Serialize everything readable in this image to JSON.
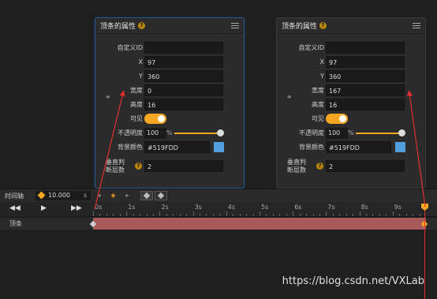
{
  "panels": [
    {
      "title": "顶条的属性",
      "help": "?",
      "fields": {
        "id_label": "自定义ID",
        "id_value": "",
        "x_label": "X",
        "x_value": "97",
        "y_label": "Y",
        "y_value": "360",
        "w_label": "宽度",
        "w_value": "0",
        "h_label": "高度",
        "h_value": "16",
        "visible_label": "可见",
        "opacity_label": "不透明度",
        "opacity_value": "100",
        "opacity_unit": "%",
        "opacity_level": 1.0,
        "color_label": "背景颜色",
        "color_value": "#519FDD",
        "hit_label": "垂直判断层数",
        "hit_value": "2"
      }
    },
    {
      "title": "顶条的属性",
      "help": "?",
      "fields": {
        "id_label": "自定义ID",
        "id_value": "",
        "x_label": "X",
        "x_value": "97",
        "y_label": "Y",
        "y_value": "360",
        "w_label": "宽度",
        "w_value": "167",
        "h_label": "高度",
        "h_value": "16",
        "visible_label": "可见",
        "opacity_label": "不透明度",
        "opacity_value": "100",
        "opacity_unit": "%",
        "opacity_level": 1.0,
        "color_label": "背景颜色",
        "color_value": "#519FDD",
        "hit_label": "垂直判断层数",
        "hit_value": "2"
      }
    }
  ],
  "timeline": {
    "label": "时间轴",
    "duration": "10.000",
    "duration_unit": "s",
    "ruler_labels": [
      "0s",
      "1s",
      "2s",
      "3s",
      "4s",
      "5s",
      "6s",
      "7s",
      "8s",
      "9s"
    ],
    "track_name": "顶条"
  },
  "colors": {
    "accent": "#f5a623",
    "track_bar": "#a85a5a",
    "swatch": "#519FDD",
    "playhead": "#e03030"
  },
  "watermark": "https://blog.csdn.net/VXLab"
}
